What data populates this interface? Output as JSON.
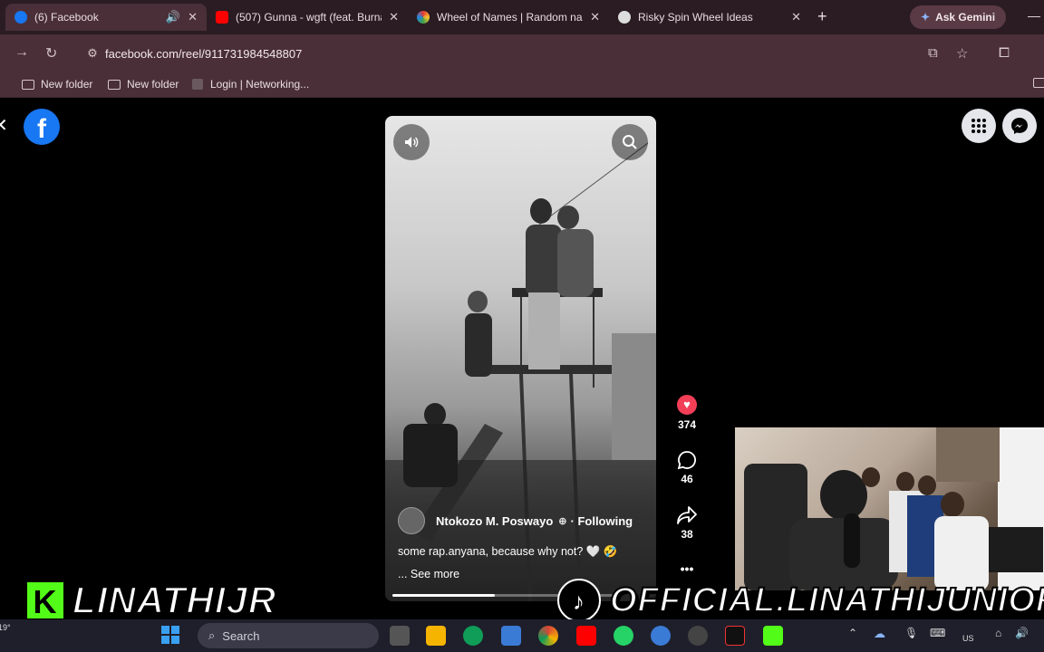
{
  "browser": {
    "tabs": [
      {
        "title": "(6) Facebook",
        "active": true
      },
      {
        "title": "(507) Gunna - wgft (feat. Burna",
        "active": false
      },
      {
        "title": "Wheel of Names | Random nam",
        "active": false
      },
      {
        "title": "Risky Spin Wheel Ideas",
        "active": false
      }
    ],
    "ask_gemini": "Ask Gemini",
    "url": "facebook.com/reel/911731984548807",
    "bookmarks": [
      "New folder",
      "New folder",
      "Login | Networking..."
    ]
  },
  "reel": {
    "owner": "Ntokozo M. Poswayo",
    "following": "· Following",
    "caption": "some rap.anyana, because why not? 🤍 🤣",
    "see_more": "... See more",
    "likes": "374",
    "comments": "46",
    "shares": "38",
    "more": "•••",
    "progress": 0.45
  },
  "overlays": {
    "left_handle": "LINATHIJR",
    "right_handle": "OFFICIAL.LINATHIJUNIOR"
  },
  "taskbar": {
    "search_placeholder": "Search",
    "temp": "19°",
    "lang": "US"
  },
  "colors": {
    "facebook_blue": "#1877f2",
    "kick_green": "#53fc18",
    "like_pink": "#f33e58"
  }
}
